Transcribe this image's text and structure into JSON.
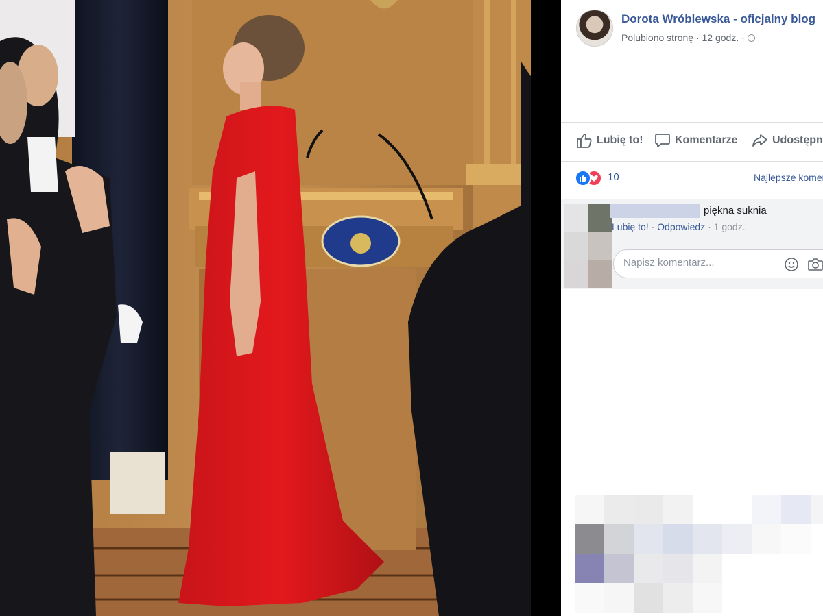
{
  "post": {
    "page_name": "Dorota Wróblewska - oficjalny blog",
    "meta": "Polubiono stronę · 12 godz. ·",
    "privacy_icon": "globe-icon"
  },
  "actions": {
    "like": "Lubię to!",
    "comment": "Komentarze",
    "share": "Udostępnij"
  },
  "reactions": {
    "types": [
      "like",
      "love"
    ],
    "count": "10",
    "sort_label": "Najlepsze komentarze"
  },
  "comment": {
    "text": "piękna suknia",
    "like_link": "Lubię to!",
    "separator": " · ",
    "reply_link": "Odpowiedz",
    "time": " · 1 godz."
  },
  "composer": {
    "placeholder": "Napisz komentarz...",
    "icons": [
      "emoji-icon",
      "camera-icon"
    ]
  },
  "colors": {
    "link": "#385898",
    "like_blue": "#1877f2",
    "love_red": "#f33e58",
    "dress_red": "#e3191c",
    "panel_bg": "#ffffff"
  }
}
